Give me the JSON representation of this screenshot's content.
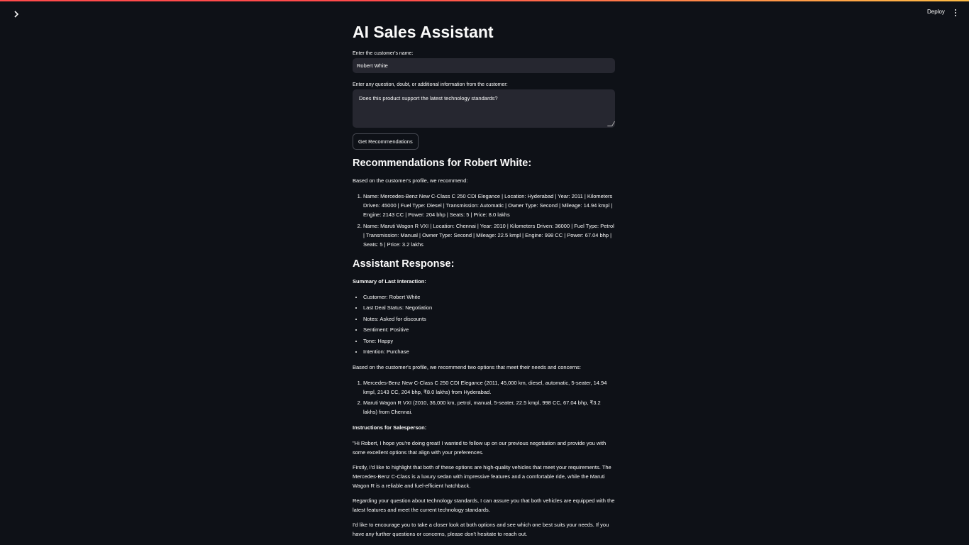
{
  "header": {
    "deploy_label": "Deploy"
  },
  "page": {
    "title": "AI Sales Assistant"
  },
  "form": {
    "name_label": "Enter the customer's name:",
    "name_value": "Robert White",
    "question_label": "Enter any question, doubt, or additional information from the customer:",
    "question_value": "Does this product support the latest technology standards?",
    "submit_label": "Get Recommendations"
  },
  "recommendations": {
    "heading": "Recommendations for Robert White:",
    "intro": "Based on the customer's profile, we recommend:",
    "items": [
      "Name: Mercedes-Benz New C-Class C 250 CDI Elegance | Location: Hyderabad | Year: 2011 | Kilometers Driven: 45000 | Fuel Type: Diesel | Transmission: Automatic | Owner Type: Second | Mileage: 14.94 kmpl | Engine: 2143 CC | Power: 204 bhp | Seats: 5 | Price: 8.0 lakhs",
      "Name: Maruti Wagon R VXI | Location: Chennai | Year: 2010 | Kilometers Driven: 36000 | Fuel Type: Petrol | Transmission: Manual | Owner Type: Second | Mileage: 22.5 kmpl | Engine: 998 CC | Power: 67.04 bhp | Seats: 5 | Price: 3.2 lakhs"
    ]
  },
  "assistant": {
    "heading": "Assistant Response:",
    "summary_title": "Summary of Last Interaction:",
    "summary_items": [
      "Customer: Robert White",
      "Last Deal Status: Negotiation",
      "Notes: Asked for discounts",
      "Sentiment: Positive",
      "Tone: Happy",
      "Intention: Purchase"
    ],
    "options_intro": "Based on the customer's profile, we recommend two options that meet their needs and concerns:",
    "options": [
      "Mercedes-Benz New C-Class C 250 CDI Elegance (2011, 45,000 km, diesel, automatic, 5-seater, 14.94 kmpl, 2143 CC, 204 bhp, ₹8.0 lakhs) from Hyderabad.",
      "Maruti Wagon R VXI (2010, 36,000 km, petrol, manual, 5-seater, 22.5 kmpl, 998 CC, 67.04 bhp, ₹3.2 lakhs) from Chennai."
    ],
    "instructions_title": "Instructions for Salesperson:",
    "paragraphs": [
      "\"Hi Robert, I hope you're doing great! I wanted to follow up on our previous negotiation and provide you with some excellent options that align with your preferences.",
      "Firstly, I'd like to highlight that both of these options are high-quality vehicles that meet your requirements. The Mercedes-Benz C-Class is a luxury sedan with impressive features and a comfortable ride, while the Maruti Wagon R is a reliable and fuel-efficient hatchback.",
      "Regarding your question about technology standards, I can assure you that both vehicles are equipped with the latest features and meet the current technology standards.",
      "I'd like to encourage you to take a closer look at both options and see which one best suits your needs. If you have any further questions or concerns, please don't hesitate to reach out."
    ]
  }
}
